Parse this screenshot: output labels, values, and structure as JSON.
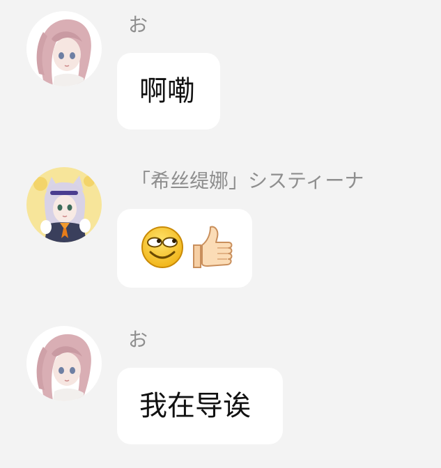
{
  "chat": {
    "messages": [
      {
        "sender": "お",
        "text": "啊嘞",
        "avatar_icon": "anime-girl-pink-hair-avatar"
      },
      {
        "sender": "「希丝缇娜」システィーナ",
        "emojis": [
          "rolling-eyes-smile-emoji",
          "thumbs-up-emoji"
        ],
        "avatar_icon": "anime-girl-cat-ears-avatar"
      },
      {
        "sender": "お",
        "text": "我在导诶",
        "avatar_icon": "anime-girl-pink-hair-avatar"
      }
    ]
  },
  "colors": {
    "background": "#f3f3f3",
    "bubble": "#ffffff",
    "sender_text": "#8e8e8e",
    "message_text": "#111111",
    "emoji_yellow": "#f7c21a"
  }
}
